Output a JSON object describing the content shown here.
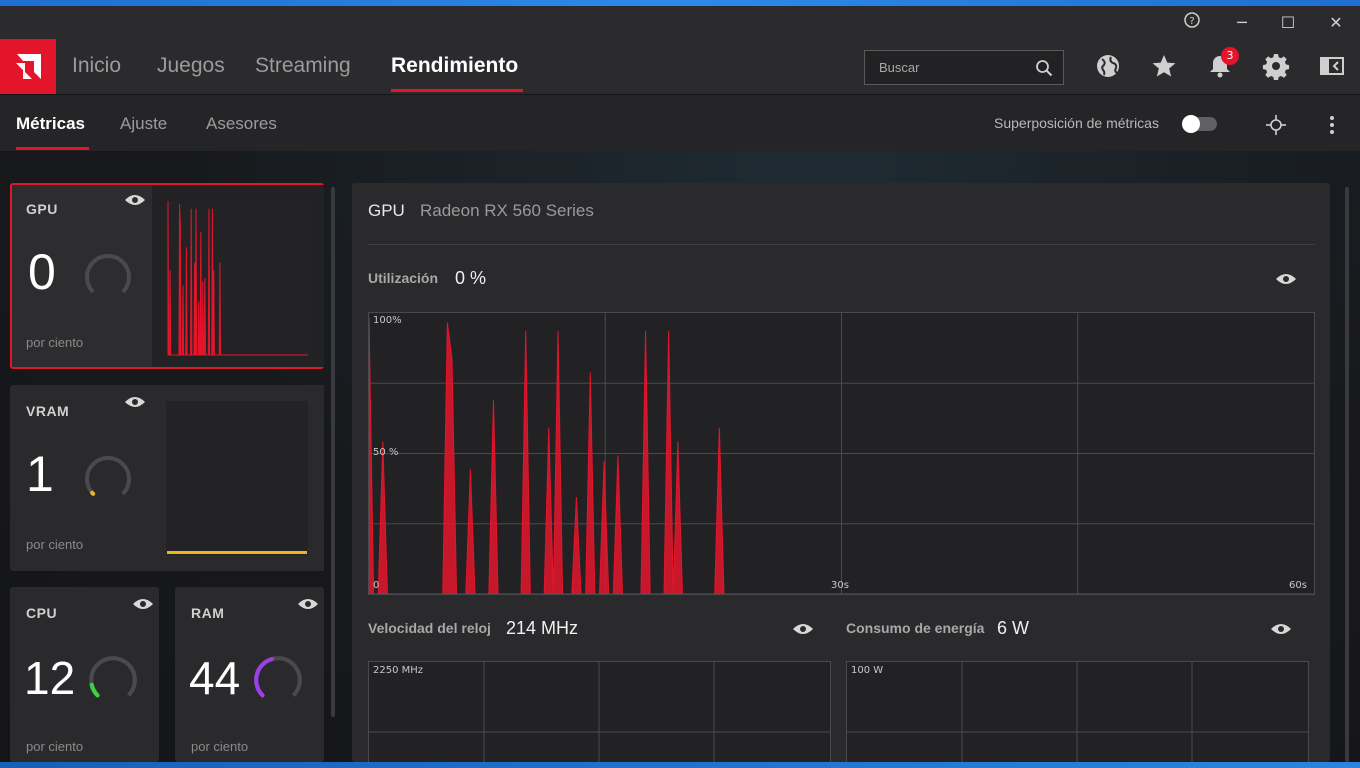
{
  "window": {
    "buttons": {
      "help": "?",
      "minimize": "─",
      "maximize": "☐",
      "close": "✕"
    }
  },
  "nav": {
    "tabs": [
      {
        "label": "Inicio"
      },
      {
        "label": "Juegos"
      },
      {
        "label": "Streaming"
      },
      {
        "label": "Rendimiento",
        "active": true
      }
    ],
    "search_placeholder": "Buscar",
    "notifications_count": "3",
    "icons": [
      "globe-icon",
      "star-icon",
      "bell-icon",
      "gear-icon",
      "sidebar-toggle-icon"
    ]
  },
  "subnav": {
    "tabs": [
      {
        "label": "Métricas",
        "active": true
      },
      {
        "label": "Ajuste"
      },
      {
        "label": "Asesores"
      }
    ],
    "overlay_label": "Superposición de métricas",
    "overlay_enabled": false
  },
  "cards": {
    "gpu": {
      "label": "GPU",
      "value": "0",
      "unit": "por ciento",
      "gauge_fraction": 0.0,
      "color": "#e4152b"
    },
    "vram": {
      "label": "VRAM",
      "value": "1",
      "unit": "por ciento",
      "gauge_fraction": 0.01,
      "color": "#f0b429"
    },
    "cpu": {
      "label": "CPU",
      "value": "12",
      "unit": "por ciento",
      "gauge_fraction": 0.12,
      "color": "#3fcf3f"
    },
    "ram": {
      "label": "RAM",
      "value": "44",
      "unit": "por ciento",
      "gauge_fraction": 0.44,
      "color": "#9b3fe8"
    }
  },
  "panel": {
    "title": "GPU",
    "subtitle": "Radeon RX 560 Series",
    "utilization": {
      "label": "Utilización",
      "value": "0 %"
    },
    "clock": {
      "label": "Velocidad del reloj",
      "value": "214 MHz",
      "axis_top": "2250 MHz"
    },
    "power": {
      "label": "Consumo de energía",
      "value": "6 W",
      "axis_top": "100 W"
    }
  },
  "chart_data": [
    {
      "type": "area",
      "title": "Utilización",
      "y_tick_labels": [
        "100%",
        "50 %",
        "0"
      ],
      "x_tick_labels": [
        "30s",
        "60s"
      ],
      "ylim": [
        0,
        100
      ],
      "xlim": [
        0,
        60
      ],
      "grid": true,
      "color": "#e4152b",
      "series": [
        {
          "values": [
            100,
            0,
            0,
            55,
            0,
            0,
            0,
            0,
            0,
            0,
            0,
            0,
            0,
            0,
            0,
            0,
            0,
            98,
            85,
            0,
            0,
            0,
            45,
            0,
            0,
            0,
            0,
            70,
            0,
            0,
            0,
            0,
            0,
            0,
            95,
            0,
            0,
            0,
            0,
            60,
            0,
            95,
            0,
            0,
            0,
            35,
            0,
            0,
            80,
            0,
            0,
            48,
            0,
            0,
            50,
            0,
            0,
            0,
            0,
            0,
            95,
            0,
            0,
            0,
            0,
            95,
            0,
            55,
            0,
            0,
            0,
            0,
            0,
            0,
            0,
            0,
            60,
            0,
            0,
            0,
            0,
            0,
            0,
            0,
            0,
            0,
            0,
            0,
            0,
            0,
            0,
            0,
            0,
            0,
            0,
            0,
            0,
            0,
            0,
            0,
            0,
            0,
            0,
            0,
            0,
            0,
            0,
            0,
            0,
            0,
            0,
            0,
            0,
            0,
            0,
            0,
            0,
            0,
            0,
            0,
            0,
            0,
            0,
            0,
            0,
            0,
            0,
            0,
            0,
            0,
            0,
            0,
            0,
            0,
            0,
            0,
            0,
            0,
            0,
            0,
            0,
            0,
            0,
            0,
            0,
            0,
            0,
            0,
            0,
            0,
            0,
            0,
            0,
            0,
            0,
            0,
            0,
            0,
            0,
            0,
            0,
            0,
            0,
            0,
            0,
            0,
            0,
            0,
            0,
            0,
            0,
            0,
            0,
            0,
            0,
            0,
            0,
            0,
            0,
            0,
            0,
            0,
            0,
            0,
            0,
            0,
            0,
            0,
            0,
            0,
            0,
            0,
            0,
            0,
            0,
            0,
            0,
            0,
            0,
            0,
            0,
            0,
            0,
            0,
            0,
            0
          ]
        }
      ]
    }
  ]
}
